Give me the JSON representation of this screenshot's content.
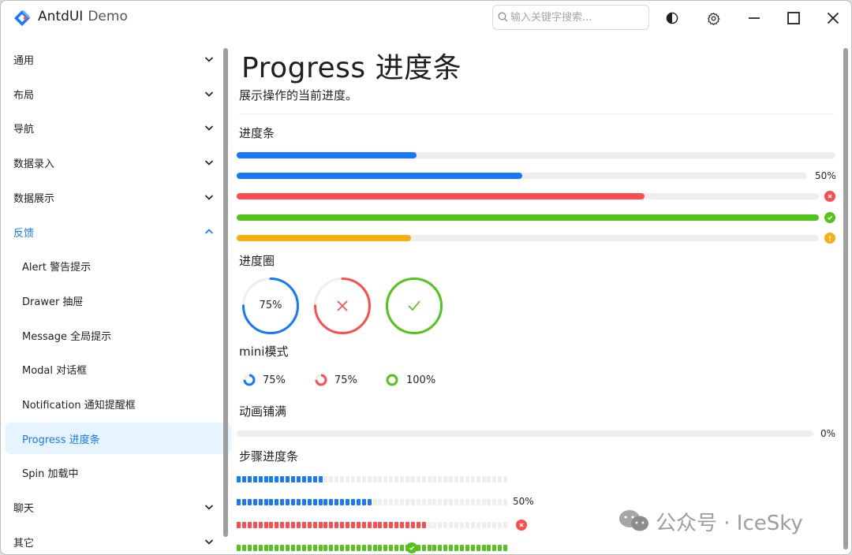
{
  "window": {
    "title": "AntdUI",
    "subtitle": "Demo",
    "search_placeholder": "输入关键字搜索...",
    "colors": {
      "primary": "#1677ff",
      "error": "#ff4d4f",
      "success": "#52c41a",
      "warning": "#faad14",
      "track": "#eeeeee"
    }
  },
  "sidebar": {
    "items": [
      {
        "label": "通用",
        "type": "group",
        "expanded": false
      },
      {
        "label": "布局",
        "type": "group",
        "expanded": false
      },
      {
        "label": "导航",
        "type": "group",
        "expanded": false
      },
      {
        "label": "数据录入",
        "type": "group",
        "expanded": false
      },
      {
        "label": "数据展示",
        "type": "group",
        "expanded": false
      },
      {
        "label": "反馈",
        "type": "group",
        "expanded": true
      },
      {
        "label": "Alert 警告提示",
        "type": "sub"
      },
      {
        "label": "Drawer 抽屉",
        "type": "sub"
      },
      {
        "label": "Message 全局提示",
        "type": "sub"
      },
      {
        "label": "Modal 对话框",
        "type": "sub"
      },
      {
        "label": "Notification 通知提醒框",
        "type": "sub"
      },
      {
        "label": "Progress 进度条",
        "type": "sub",
        "selected": true
      },
      {
        "label": "Spin 加载中",
        "type": "sub"
      },
      {
        "label": "聊天",
        "type": "group",
        "expanded": false
      },
      {
        "label": "其它",
        "type": "group",
        "expanded": false
      }
    ]
  },
  "page": {
    "title": "Progress 进度条",
    "description": "展示操作的当前进度。",
    "sections": {
      "bars": "进度条",
      "circles": "进度圈",
      "mini": "mini模式",
      "animated": "动画铺满",
      "steps": "步骤进度条"
    },
    "bars": [
      {
        "value": 0.3,
        "status": "normal",
        "label": ""
      },
      {
        "value": 0.5,
        "status": "normal",
        "label": "50%"
      },
      {
        "value": 0.7,
        "status": "error",
        "label": ""
      },
      {
        "value": 1.0,
        "status": "success",
        "label": ""
      },
      {
        "value": 0.3,
        "status": "warning",
        "label": ""
      }
    ],
    "circles": [
      {
        "value": 0.75,
        "status": "normal",
        "label": "75%"
      },
      {
        "value": 0.75,
        "status": "error",
        "label": ""
      },
      {
        "value": 1.0,
        "status": "success",
        "label": ""
      }
    ],
    "mini": [
      {
        "value": 0.75,
        "status": "normal",
        "label": "75%"
      },
      {
        "value": 0.75,
        "status": "error",
        "label": "75%"
      },
      {
        "value": 1.0,
        "status": "success",
        "label": "100%"
      }
    ],
    "animated": {
      "value": 0,
      "label": "0%"
    },
    "steps": [
      {
        "value": 0.32,
        "status": "normal",
        "label": ""
      },
      {
        "value": 0.5,
        "status": "normal",
        "label": "50%"
      },
      {
        "value": 0.7,
        "status": "error",
        "label": ""
      },
      {
        "value": 1.0,
        "status": "success",
        "label": ""
      }
    ]
  },
  "watermark": "公众号 · IceSky"
}
